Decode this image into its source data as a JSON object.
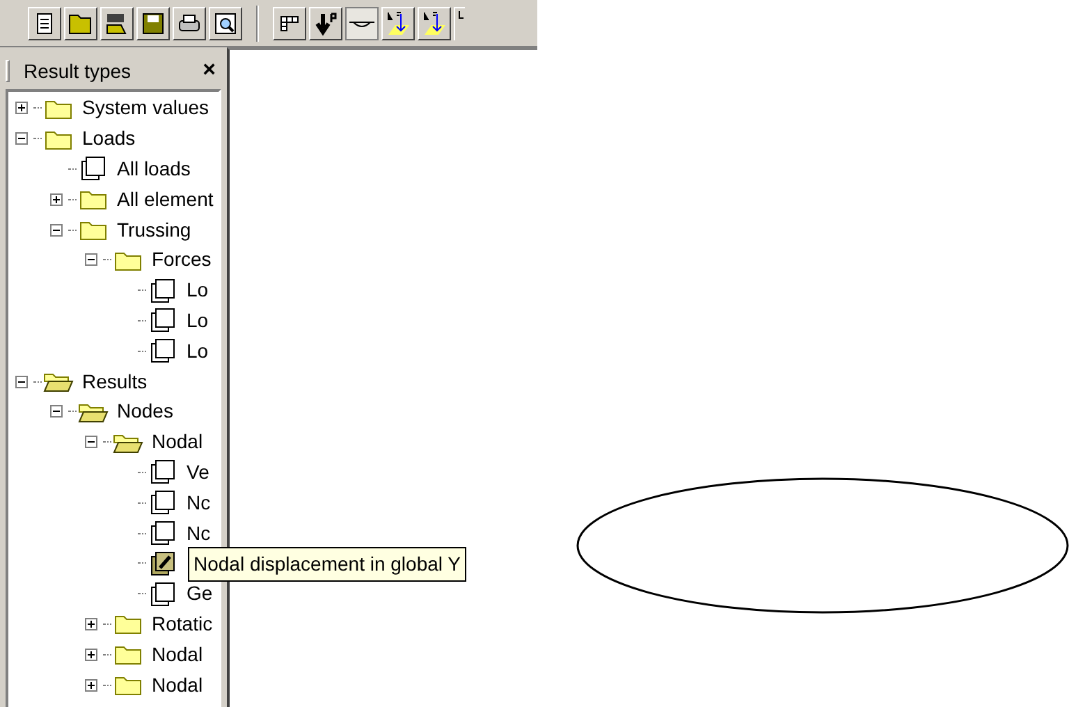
{
  "panel": {
    "title": "Result types",
    "close": "×"
  },
  "tree": [
    {
      "label": "System values",
      "kind": "folder",
      "expanded": false,
      "selected": false
    },
    {
      "label": "Loads",
      "kind": "folder",
      "expanded": true,
      "selected": false,
      "children": [
        {
          "label": "All loads",
          "kind": "page",
          "selected": false
        },
        {
          "label": "All element",
          "kind": "folder",
          "expanded": false,
          "selected": false
        },
        {
          "label": "Trussing",
          "kind": "folder",
          "expanded": true,
          "selected": false,
          "children": [
            {
              "label": "Forces",
              "kind": "folder",
              "expanded": true,
              "selected": false,
              "children": [
                {
                  "label": "Lo",
                  "kind": "page",
                  "selected": false
                },
                {
                  "label": "Lo",
                  "kind": "page",
                  "selected": false
                },
                {
                  "label": "Lo",
                  "kind": "page",
                  "selected": false
                }
              ]
            }
          ]
        }
      ]
    },
    {
      "label": "Results",
      "kind": "open-folder",
      "expanded": true,
      "selected": false,
      "children": [
        {
          "label": "Nodes",
          "kind": "open-folder",
          "expanded": true,
          "selected": false,
          "children": [
            {
              "label": "Nodal",
              "kind": "open-folder",
              "expanded": true,
              "selected": false,
              "children": [
                {
                  "label": "Ve",
                  "kind": "page",
                  "selected": false
                },
                {
                  "label": "Nc",
                  "kind": "page",
                  "selected": false
                },
                {
                  "label": "Nc",
                  "kind": "page",
                  "selected": false
                },
                {
                  "kind": "page",
                  "selected": true
                },
                {
                  "label": "Ge",
                  "kind": "page",
                  "selected": false
                }
              ]
            },
            {
              "label": "Rotatic",
              "kind": "folder",
              "expanded": false,
              "selected": false
            },
            {
              "label": "Nodal",
              "kind": "folder",
              "expanded": false,
              "selected": false
            },
            {
              "label": "Nodal",
              "kind": "folder",
              "expanded": false,
              "selected": false
            }
          ]
        }
      ]
    }
  ],
  "tooltip": "Nodal displacement in global Y"
}
